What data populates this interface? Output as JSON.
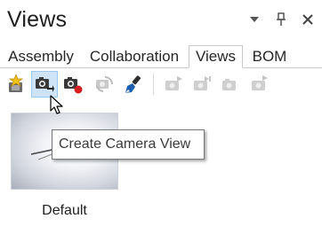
{
  "panel": {
    "title": "Views",
    "controls": {
      "dropdown_icon": "chevron-down-icon",
      "pin_icon": "pin-icon",
      "close_icon": "close-icon"
    }
  },
  "tabs": [
    {
      "label": "Assembly",
      "active": false
    },
    {
      "label": "Collaboration",
      "active": false
    },
    {
      "label": "Views",
      "active": true
    },
    {
      "label": "BOM",
      "active": false
    }
  ],
  "toolbar": {
    "buttons": [
      {
        "icon": "new-view-icon",
        "enabled": true
      },
      {
        "icon": "create-camera-view-icon",
        "enabled": true,
        "hovered": true
      },
      {
        "icon": "record-camera-view-icon",
        "enabled": true
      },
      {
        "icon": "refresh-view-icon",
        "enabled": false
      },
      {
        "icon": "clear-paint-icon",
        "enabled": true
      },
      {
        "icon": "camera-play-icon",
        "enabled": false
      },
      {
        "icon": "camera-step-icon",
        "enabled": false
      },
      {
        "icon": "camera-icon",
        "enabled": false
      },
      {
        "icon": "camera-next-icon",
        "enabled": false
      }
    ]
  },
  "tooltip": {
    "text": "Create Camera View"
  },
  "views": [
    {
      "label": "Default"
    }
  ],
  "colors": {
    "hover_bg": "#cfe5f7",
    "hover_border": "#99c9ef",
    "record_red": "#d42020",
    "tab_border": "#c8c8c8"
  }
}
